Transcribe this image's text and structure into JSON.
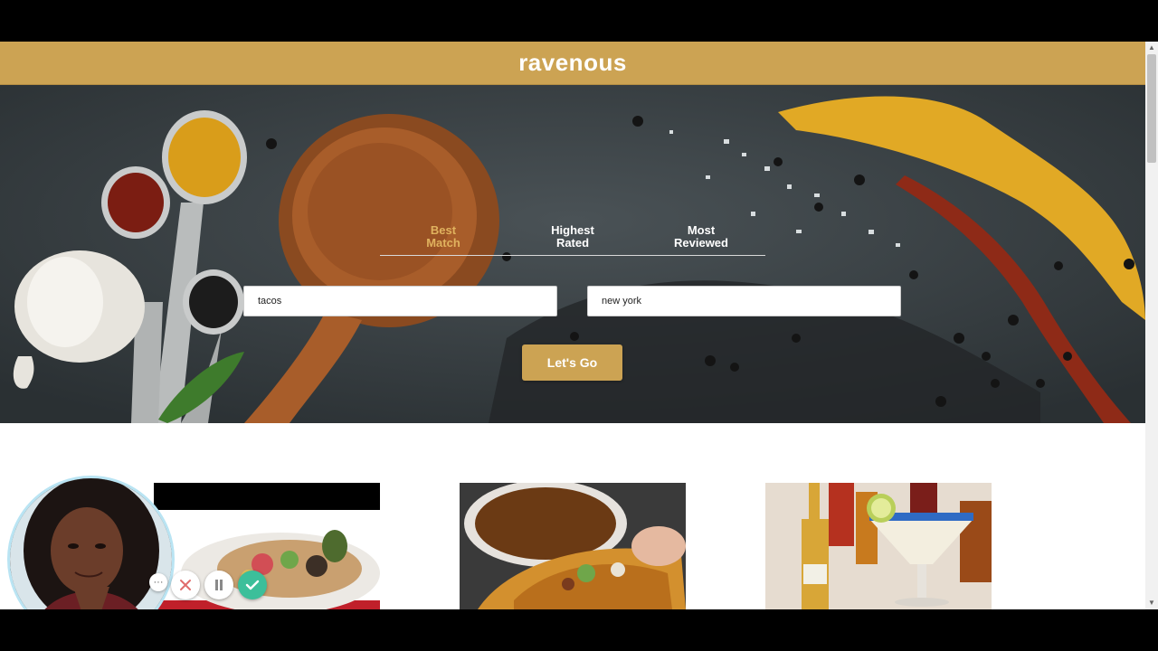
{
  "app": {
    "brand": "ravenous"
  },
  "search": {
    "tabs": [
      {
        "line1": "Best",
        "line2": "Match",
        "active": true
      },
      {
        "line1": "Highest",
        "line2": "Rated",
        "active": false
      },
      {
        "line1": "Most",
        "line2": "Reviewed",
        "active": false
      }
    ],
    "term_value": "tacos",
    "location_value": "new york",
    "submit_label": "Let's Go"
  },
  "recorder": {
    "more_label": "···",
    "cancel_icon": "close-icon",
    "pause_icon": "pause-icon",
    "confirm_icon": "check-icon"
  },
  "colors": {
    "accent": "#cca353",
    "active_tab": "#e0b25e",
    "cancel": "#e06b6b",
    "confirm": "#3cbf9a"
  }
}
